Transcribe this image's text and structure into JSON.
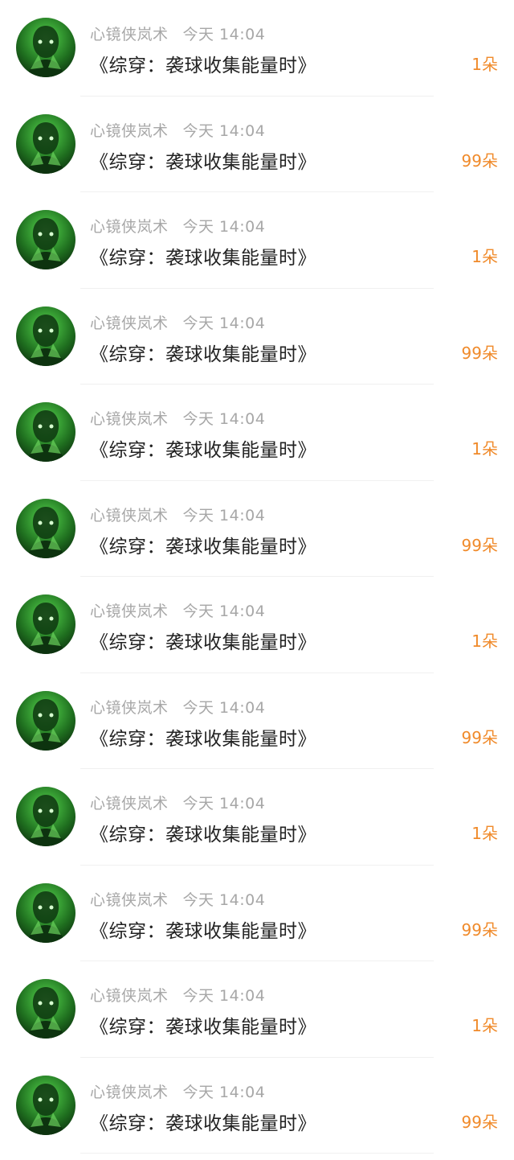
{
  "messages": [
    {
      "user": "心镜侠岚术",
      "time": "今天 14:04",
      "title": "《综穿：袭球收集能量时》",
      "gift": "1朵"
    },
    {
      "user": "心镜侠岚术",
      "time": "今天 14:04",
      "title": "《综穿：袭球收集能量时》",
      "gift": "99朵"
    },
    {
      "user": "心镜侠岚术",
      "time": "今天 14:04",
      "title": "《综穿：袭球收集能量时》",
      "gift": "1朵"
    },
    {
      "user": "心镜侠岚术",
      "time": "今天 14:04",
      "title": "《综穿：袭球收集能量时》",
      "gift": "99朵"
    },
    {
      "user": "心镜侠岚术",
      "time": "今天 14:04",
      "title": "《综穿：袭球收集能量时》",
      "gift": "1朵"
    },
    {
      "user": "心镜侠岚术",
      "time": "今天 14:04",
      "title": "《综穿：袭球收集能量时》",
      "gift": "99朵"
    },
    {
      "user": "心镜侠岚术",
      "time": "今天 14:04",
      "title": "《综穿：袭球收集能量时》",
      "gift": "1朵"
    },
    {
      "user": "心镜侠岚术",
      "time": "今天 14:04",
      "title": "《综穿：袭球收集能量时》",
      "gift": "99朵"
    },
    {
      "user": "心镜侠岚术",
      "time": "今天 14:04",
      "title": "《综穿：袭球收集能量时》",
      "gift": "1朵"
    },
    {
      "user": "心镜侠岚术",
      "time": "今天 14:04",
      "title": "《综穿：袭球收集能量时》",
      "gift": "99朵"
    },
    {
      "user": "心镜侠岚术",
      "time": "今天 14:04",
      "title": "《综穿：袭球收集能量时》",
      "gift": "1朵"
    },
    {
      "user": "心镜侠岚术",
      "time": "今天 14:04",
      "title": "《综穿：袭球收集能量时》",
      "gift": "99朵"
    }
  ],
  "avatar_icon": "user-avatar-green-character",
  "colors": {
    "gift": "#f08a2a",
    "meta": "#a7a7a7",
    "title": "#222222",
    "avatar_green": "#3aa336"
  }
}
